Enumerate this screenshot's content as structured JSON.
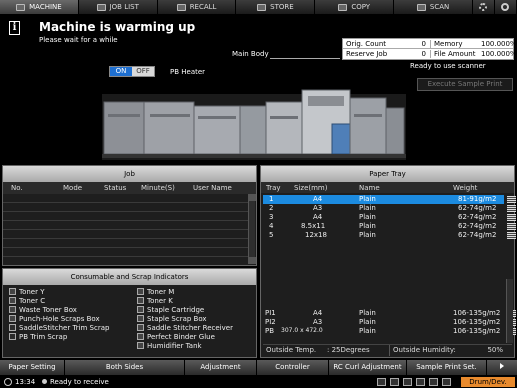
{
  "tabs": [
    {
      "label": "MACHINE",
      "icon": "machine-icon",
      "active": true
    },
    {
      "label": "JOB LIST",
      "icon": "job-list-icon"
    },
    {
      "label": "RECALL",
      "icon": "recall-icon"
    },
    {
      "label": "STORE",
      "icon": "store-icon"
    },
    {
      "label": "COPY",
      "icon": "copy-icon"
    },
    {
      "label": "SCAN",
      "icon": "scan-icon"
    }
  ],
  "header": {
    "title": "Machine is warming up",
    "subtitle": "Please wait for a while",
    "main_body": "Main Body"
  },
  "counters": {
    "orig_count_label": "Orig. Count",
    "orig_count": "0",
    "memory_label": "Memory",
    "memory": "100.000%",
    "reserve_job_label": "Reserve Job",
    "reserve_job": "0",
    "file_amount_label": "File Amount",
    "file_amount": "100.000%"
  },
  "machine": {
    "on_label": "ON",
    "off_label": "OFF",
    "pb_heater": "PB Heater",
    "ready_scanner": "Ready to use scanner",
    "execute_sample_print": "Execute Sample Print"
  },
  "job_panel": {
    "title": "Job",
    "columns": {
      "no": "No.",
      "mode": "Mode",
      "status": "Status",
      "minute": "Minute(S)",
      "user": "User Name"
    }
  },
  "consumables": {
    "title": "Consumable and Scrap Indicators",
    "left": [
      "Toner Y",
      "Toner C",
      "Waste Toner Box",
      "Punch-Hole Scraps Box",
      "SaddleStitcher Trim Scrap",
      "PB Trim Scrap"
    ],
    "right": [
      "Toner M",
      "Toner K",
      "Staple Cartridge",
      "Staple Scrap Box",
      "Saddle Stitcher Receiver",
      "Perfect Binder Glue",
      "Humidifier Tank"
    ]
  },
  "paper_tray": {
    "title": "Paper Tray",
    "columns": {
      "tray": "Tray",
      "size": "Size(mm)",
      "name": "Name",
      "weight": "Weight"
    },
    "rows": [
      {
        "tray": "1",
        "size": "A4",
        "name": "Plain",
        "weight": "81-91g/m2"
      },
      {
        "tray": "2",
        "size": "A3",
        "name": "Plain",
        "weight": "62-74g/m2"
      },
      {
        "tray": "3",
        "size": "A4",
        "name": "Plain",
        "weight": "62-74g/m2"
      },
      {
        "tray": "4",
        "size": "8.5x11",
        "name": "Plain",
        "weight": "62-74g/m2"
      },
      {
        "tray": "5",
        "size": "12x18",
        "name": "Plain",
        "weight": "62-74g/m2"
      }
    ],
    "pi_rows": [
      {
        "tray": "PI1",
        "size": "A4",
        "name": "Plain",
        "weight": "106-135g/m2"
      },
      {
        "tray": "PI2",
        "size": "A3",
        "name": "Plain",
        "weight": "106-135g/m2"
      },
      {
        "tray": "PB",
        "size": "307.0 x 472.0",
        "name": "Plain",
        "weight": "106-135g/m2"
      }
    ],
    "outside_temp_label": "Outside Temp.",
    "outside_temp": ": 25Degrees",
    "outside_humidity_label": "Outside Humidity:",
    "outside_humidity": "50%"
  },
  "buttons": {
    "paper_setting": "Paper Setting",
    "both_sides": "Both Sides",
    "adjustment": "Adjustment",
    "controller": "Controller",
    "rc_curl": "RC Curl Adjustment",
    "sample_print_set": "Sample Print Set."
  },
  "status": {
    "time": "13:34",
    "message": "Ready to receive",
    "drum": "Drum/Dev."
  },
  "colors": {
    "selected_row": "#1c8be0",
    "toggle_on": "#1e6fd0",
    "drum_badge": "#e88a2d"
  }
}
